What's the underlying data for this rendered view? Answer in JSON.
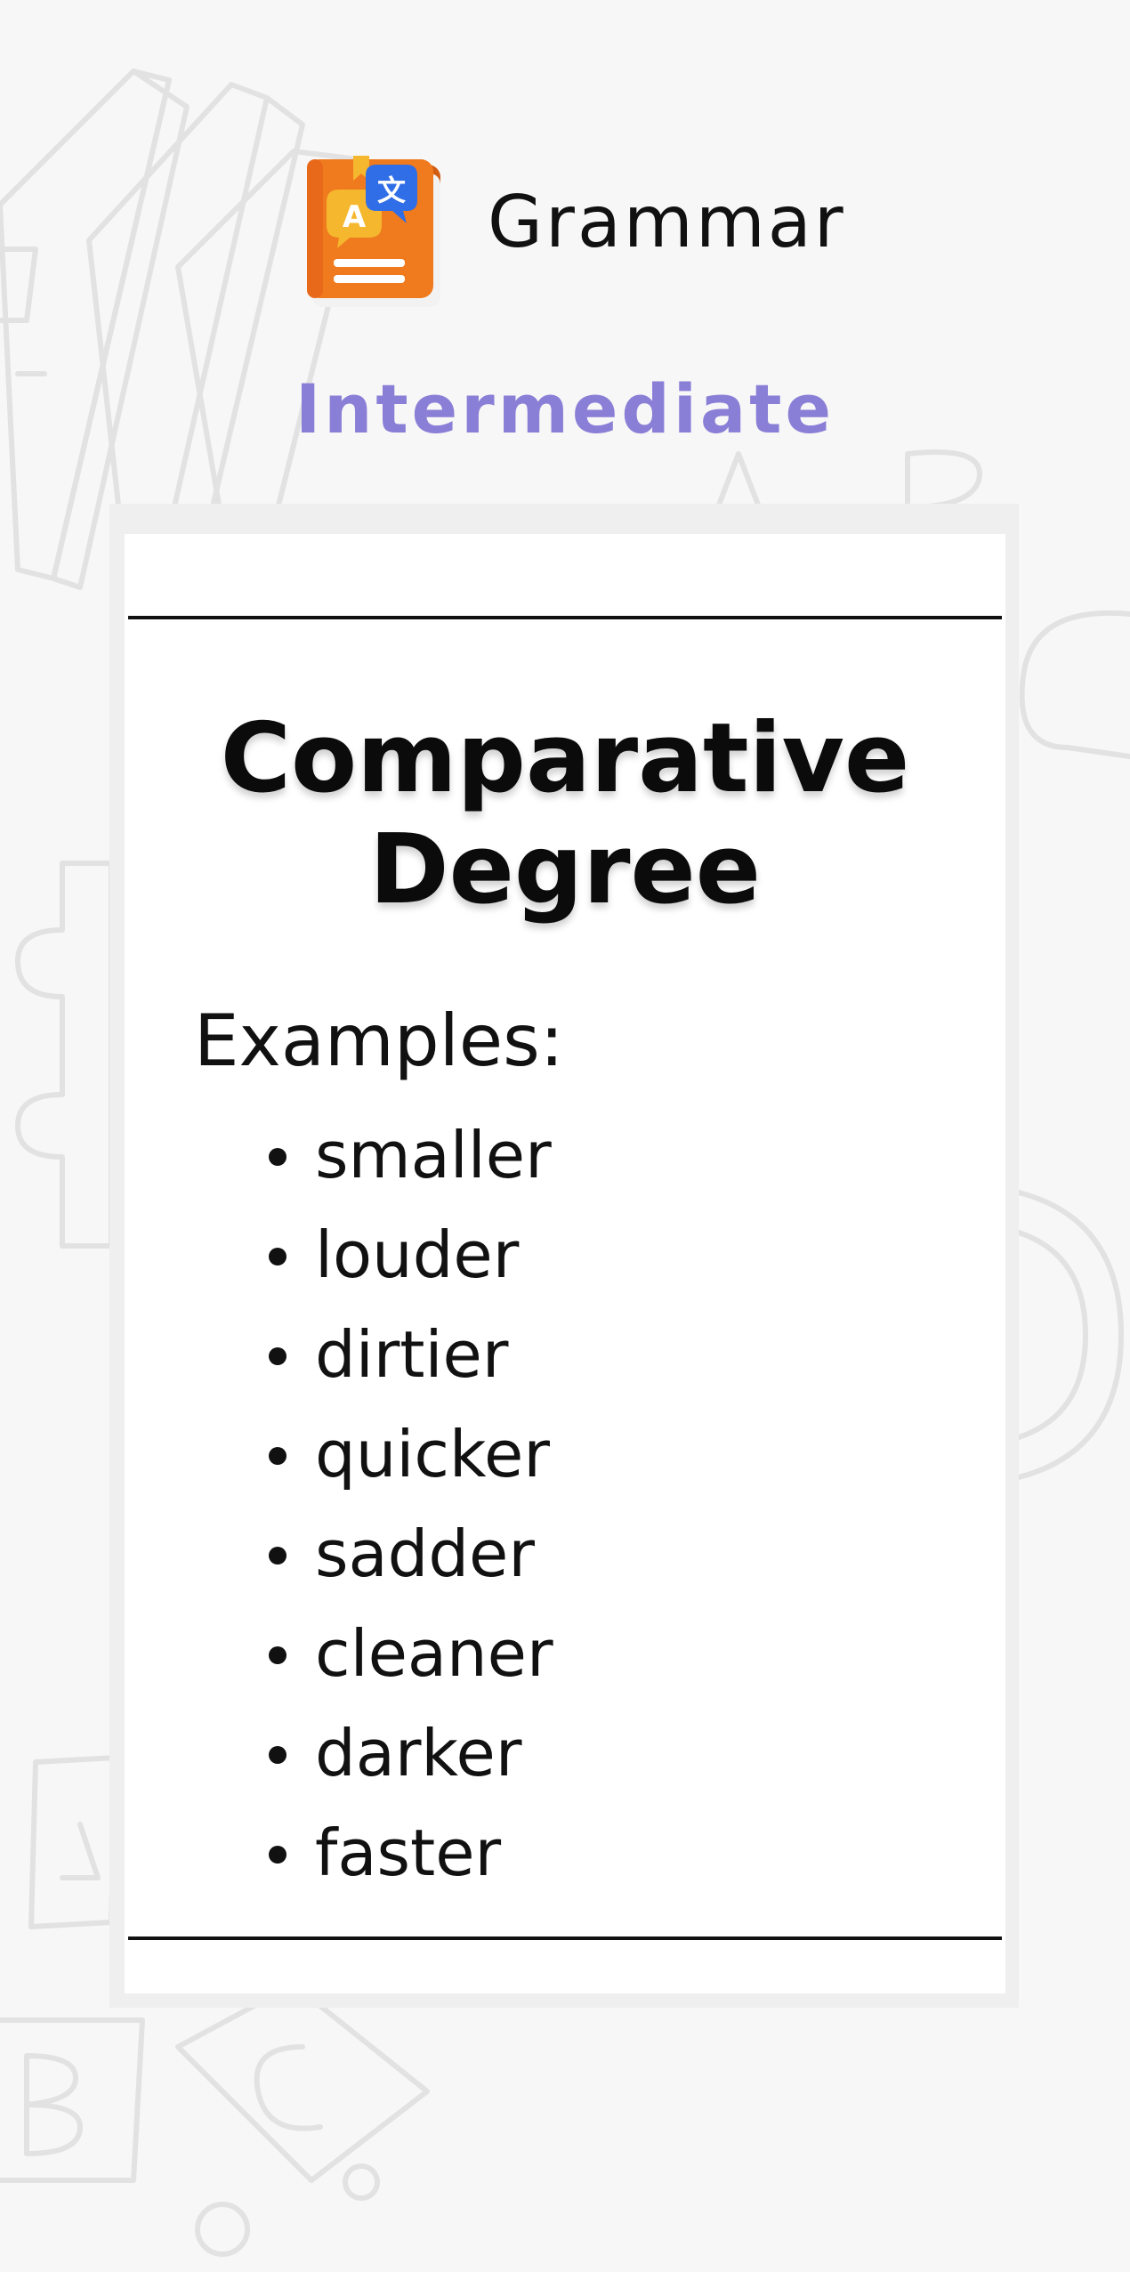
{
  "header": {
    "app_icon": "grammar-book-translate-icon",
    "title": "Grammar",
    "level": "Intermediate"
  },
  "card": {
    "title": "Comparative Degree",
    "examples_label": "Examples:",
    "examples": [
      "smaller",
      "louder",
      "dirtier",
      "quicker",
      "sadder",
      "cleaner",
      "darker",
      "faster"
    ]
  },
  "colors": {
    "background": "#f7f7f7",
    "level_text": "#8a7fd6",
    "icon_orange": "#f07a1e",
    "icon_blue": "#2f6ee6",
    "icon_yellow": "#f5b72e",
    "card": "#ffffff",
    "rule": "#111111"
  }
}
